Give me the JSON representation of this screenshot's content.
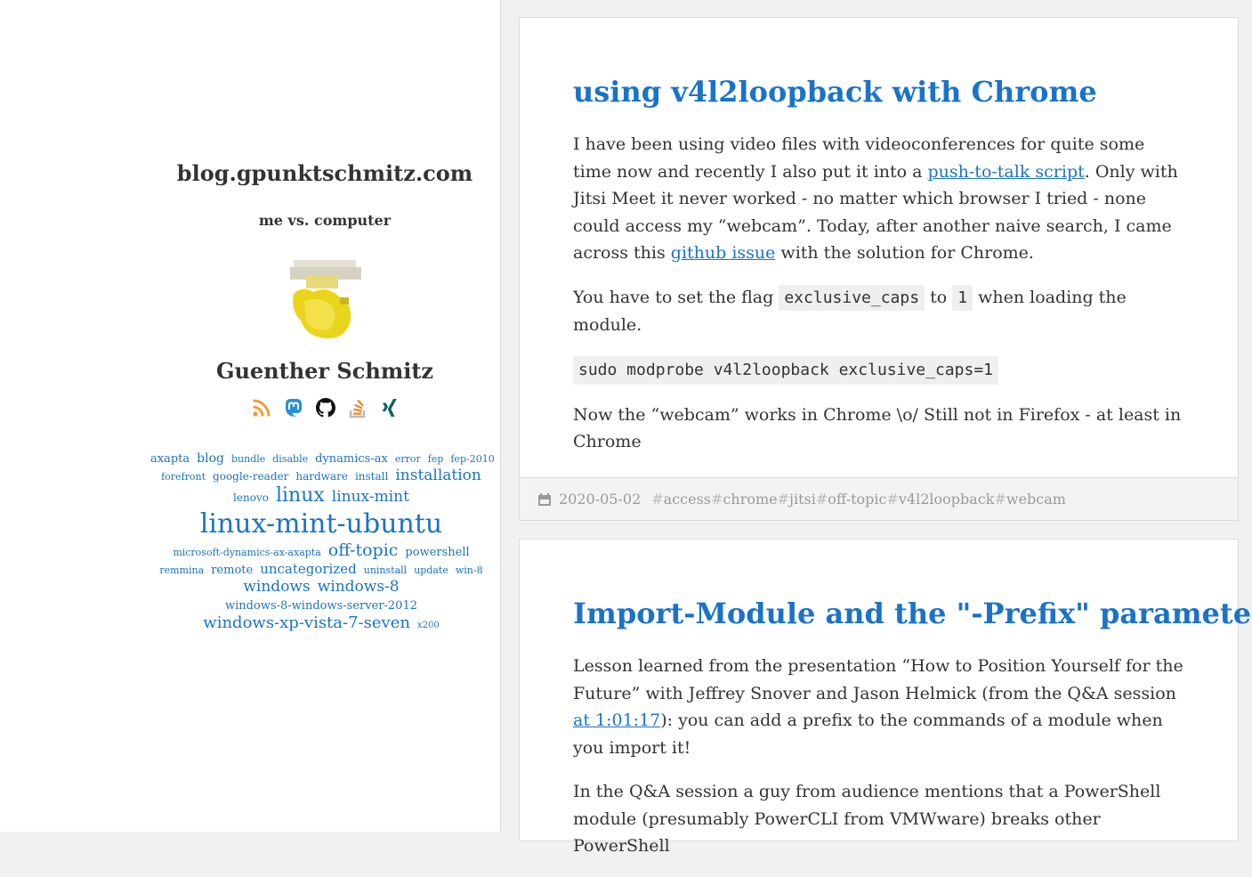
{
  "site": {
    "title": "blog.gpunktschmitz.com",
    "description": "me vs. computer",
    "author": "Guenther Schmitz"
  },
  "social": [
    {
      "icon": "rss-icon",
      "color": "#f29a38"
    },
    {
      "icon": "mastodon-icon",
      "color": "#2b90d9"
    },
    {
      "icon": "github-icon",
      "color": "#111111"
    },
    {
      "icon": "stackoverflow-icon",
      "color": "#f48024"
    },
    {
      "icon": "xing-icon",
      "color": "#026466"
    }
  ],
  "tagcloud": {
    "rows": [
      [
        {
          "t": "axapta",
          "s": 13
        },
        {
          "t": "blog",
          "s": 14
        },
        {
          "t": "bundle",
          "s": 11
        },
        {
          "t": "disable",
          "s": 11
        },
        {
          "t": "dynamics-ax",
          "s": 13
        },
        {
          "t": "error",
          "s": 11
        },
        {
          "t": "fep",
          "s": 11
        },
        {
          "t": "fep-2010",
          "s": 11
        }
      ],
      [
        {
          "t": "forefront",
          "s": 11
        },
        {
          "t": "google-reader",
          "s": 12
        },
        {
          "t": "hardware",
          "s": 12
        },
        {
          "t": "install",
          "s": 12
        },
        {
          "t": "installation",
          "s": 17
        }
      ],
      [
        {
          "t": "lenovo",
          "s": 12
        },
        {
          "t": "linux",
          "s": 22
        },
        {
          "t": "linux-mint",
          "s": 17
        }
      ],
      [
        {
          "t": "linux-mint-ubuntu",
          "s": 30
        }
      ],
      [
        {
          "t": "microsoft-dynamics-ax-axapta",
          "s": 11
        },
        {
          "t": "off-topic",
          "s": 19
        },
        {
          "t": "powershell",
          "s": 13
        }
      ],
      [
        {
          "t": "remmina",
          "s": 11
        },
        {
          "t": "remote",
          "s": 13
        },
        {
          "t": "uncategorized",
          "s": 15
        },
        {
          "t": "uninstall",
          "s": 11
        },
        {
          "t": "update",
          "s": 11
        },
        {
          "t": "win-8",
          "s": 11
        }
      ],
      [
        {
          "t": "windows",
          "s": 17
        },
        {
          "t": "windows-8",
          "s": 17
        }
      ],
      [
        {
          "t": "windows-8-windows-server-2012",
          "s": 13
        }
      ],
      [
        {
          "t": "windows-xp-vista-7-seven",
          "s": 18
        },
        {
          "t": "x200",
          "s": 10
        }
      ]
    ]
  },
  "posts": [
    {
      "title": "using v4l2loopback with Chrome",
      "p1_a": "I have been using video files with videoconferences for quite some time now and recently I also put it into a ",
      "p1_link1": "push-to-talk script",
      "p1_b": ". Only with Jitsi Meet it never worked - no matter which browser I tried - none could access my “webcam”. Today, after another naive search, I came across this ",
      "p1_link2": "github issue",
      "p1_c": " with the solution for Chrome.",
      "p2_a": "You have to set the flag ",
      "p2_code1": "exclusive_caps",
      "p2_b": " to ",
      "p2_code2": "1",
      "p2_c": " when loading the module.",
      "code": "sudo modprobe v4l2loopback exclusive_caps=1",
      "p3": "Now the “webcam” works in Chrome \\o/ Still not in Firefox - at least in Chrome",
      "date": "2020-05-02",
      "tags": [
        "access",
        "chrome",
        "jitsi",
        "off-topic",
        "v4l2loopback",
        "webcam"
      ]
    },
    {
      "title": "Import-Module and the \"-Prefix\" parameter",
      "p1_a": "Lesson learned from the presentation “How to Position Yourself for the Future” with Jeffrey Snover and Jason Helmick (from the Q&A session ",
      "p1_link1": "at 1:01:17",
      "p1_b": "): you can add a prefix to the commands of a module when you import it!",
      "p2": "In the Q&A session a guy from audience mentions that a PowerShell module (presumably PowerCLI from VMWware) breaks other PowerShell"
    }
  ]
}
